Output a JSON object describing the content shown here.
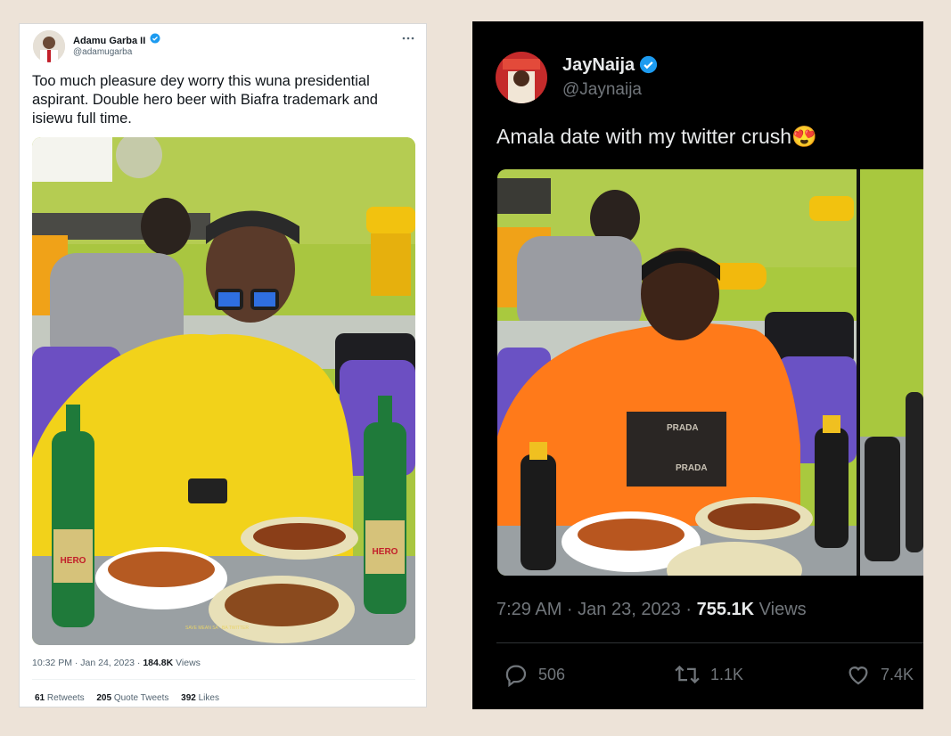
{
  "left_tweet": {
    "author_name": "Adamu Garba II",
    "author_handle": "@adamugarba",
    "more_icon": "more-horizontal-icon",
    "text_lines": [
      "Too much pleasure dey worry this wuna presidential",
      "aspirant. Double hero beer with Biafra trademark and",
      "isiewu full time."
    ],
    "photo_description_icon": "photo-man-yellow-shirt",
    "bottle_label": "HERO",
    "watermark": "SAVE MEAN SA · BA TWITTER",
    "timestamp": "10:32 PM · Jan 24, 2023 ·",
    "views_count": "184.8K",
    "views_label": "Views",
    "retweets_count": "61",
    "retweets_label": "Retweets",
    "quotes_count": "205",
    "quotes_label": "Quote Tweets",
    "likes_count": "392",
    "likes_label": "Likes"
  },
  "right_tweet": {
    "author_name": "JayNaija",
    "author_handle": "@Jaynaija",
    "text": "Amala date with my twitter crush",
    "emoji": "😍",
    "shirt_text_1": "PRADA",
    "shirt_text_2": "PRADA",
    "timestamp": "7:29 AM · Jan 23, 2023 ·",
    "views_count": "755.1K",
    "views_label": "Views",
    "replies_count": "506",
    "retweets_count": "1.1K",
    "likes_count": "7.4K"
  },
  "colors": {
    "page_background": "#ede3d8",
    "verified_blue": "#1d9bf0",
    "yellow_shirt": "#f2d21a",
    "orange_shirt": "#ff7a1a",
    "wall_green": "#a9c93e",
    "hero_bottle_green": "#1f7a3a"
  }
}
